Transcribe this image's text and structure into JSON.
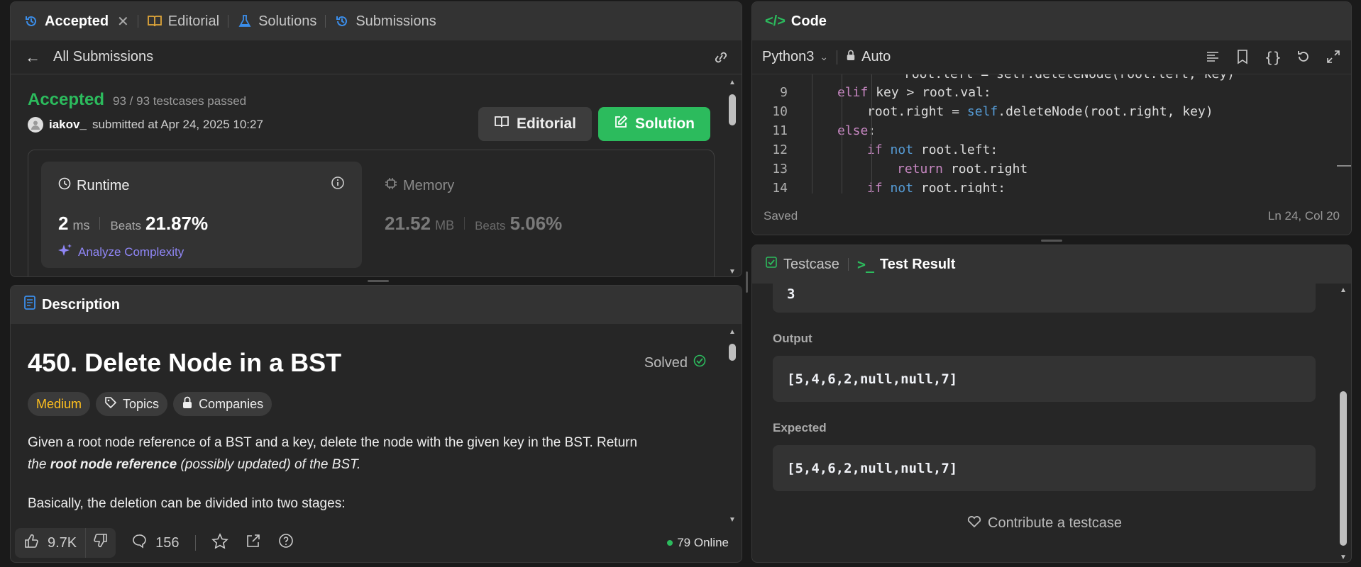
{
  "submission": {
    "tabs": {
      "accepted": "Accepted",
      "editorial": "Editorial",
      "solutions": "Solutions",
      "submissions": "Submissions"
    },
    "back_label": "All Submissions",
    "status": "Accepted",
    "testcases": "93 / 93 testcases passed",
    "user": "iakov_",
    "submitted_at": "submitted at Apr 24, 2025 10:27",
    "editorial_btn": "Editorial",
    "solution_btn": "Solution",
    "runtime": {
      "label": "Runtime",
      "value": "2",
      "unit": "ms",
      "beats_label": "Beats",
      "beats": "21.87%",
      "analyze": "Analyze Complexity"
    },
    "memory": {
      "label": "Memory",
      "value": "21.52",
      "unit": "MB",
      "beats_label": "Beats",
      "beats": "5.06%"
    }
  },
  "description": {
    "tab": "Description",
    "title": "450. Delete Node in a BST",
    "solved": "Solved",
    "difficulty": "Medium",
    "topics": "Topics",
    "companies": "Companies",
    "p1_a": "Given a root node reference of a BST and a key, delete the node with the given key in the BST. Return",
    "p1_b": "the",
    "p1_c": "root node reference",
    "p1_d": "(possibly updated) of the BST.",
    "p2": "Basically, the deletion can be divided into two stages:",
    "likes": "9.7K",
    "comments": "156",
    "online": "79 Online"
  },
  "code": {
    "tab": "Code",
    "language": "Python3",
    "mode": "Auto",
    "status": "Saved",
    "cursor": "Ln 24, Col 20",
    "lines": [
      {
        "n": "9",
        "indent": 2,
        "tokens": [
          {
            "t": "elif",
            "c": "kw"
          },
          {
            "t": " key > root.val:",
            "c": ""
          }
        ]
      },
      {
        "n": "10",
        "indent": 3,
        "tokens": [
          {
            "t": "root.right = ",
            "c": ""
          },
          {
            "t": "self",
            "c": "kw2"
          },
          {
            "t": ".deleteNode(root.right, key)",
            "c": ""
          }
        ]
      },
      {
        "n": "11",
        "indent": 2,
        "tokens": [
          {
            "t": "else",
            "c": "kw"
          },
          {
            "t": ":",
            "c": ""
          }
        ]
      },
      {
        "n": "12",
        "indent": 3,
        "tokens": [
          {
            "t": "if",
            "c": "kw"
          },
          {
            "t": " ",
            "c": ""
          },
          {
            "t": "not",
            "c": "kw2"
          },
          {
            "t": " root.left:",
            "c": ""
          }
        ]
      },
      {
        "n": "13",
        "indent": 4,
        "tokens": [
          {
            "t": "return",
            "c": "kw"
          },
          {
            "t": " root.right",
            "c": ""
          }
        ]
      },
      {
        "n": "14",
        "indent": 3,
        "tokens": [
          {
            "t": "if",
            "c": "kw"
          },
          {
            "t": " ",
            "c": ""
          },
          {
            "t": "not",
            "c": "kw2"
          },
          {
            "t": " root.right:",
            "c": ""
          }
        ]
      }
    ]
  },
  "result": {
    "tab_testcase": "Testcase",
    "tab_result": "Test Result",
    "input_tail": "3",
    "output_label": "Output",
    "output": "[5,4,6,2,null,null,7]",
    "expected_label": "Expected",
    "expected": "[5,4,6,2,null,null,7]",
    "contribute": "Contribute a testcase"
  }
}
